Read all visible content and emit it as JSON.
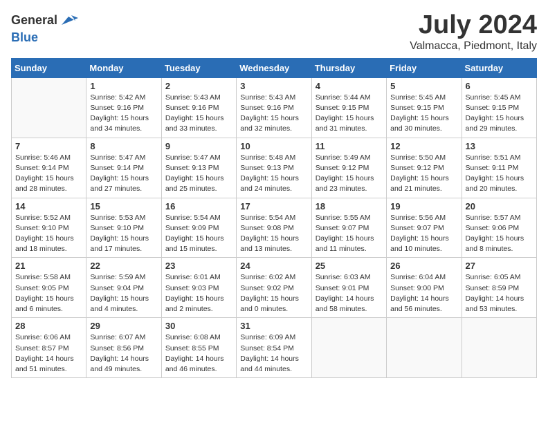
{
  "header": {
    "logo_line1": "General",
    "logo_line2": "Blue",
    "month_title": "July 2024",
    "location": "Valmacca, Piedmont, Italy"
  },
  "weekdays": [
    "Sunday",
    "Monday",
    "Tuesday",
    "Wednesday",
    "Thursday",
    "Friday",
    "Saturday"
  ],
  "weeks": [
    [
      {
        "day": "",
        "sunrise": "",
        "sunset": "",
        "daylight": ""
      },
      {
        "day": "1",
        "sunrise": "Sunrise: 5:42 AM",
        "sunset": "Sunset: 9:16 PM",
        "daylight": "Daylight: 15 hours and 34 minutes."
      },
      {
        "day": "2",
        "sunrise": "Sunrise: 5:43 AM",
        "sunset": "Sunset: 9:16 PM",
        "daylight": "Daylight: 15 hours and 33 minutes."
      },
      {
        "day": "3",
        "sunrise": "Sunrise: 5:43 AM",
        "sunset": "Sunset: 9:16 PM",
        "daylight": "Daylight: 15 hours and 32 minutes."
      },
      {
        "day": "4",
        "sunrise": "Sunrise: 5:44 AM",
        "sunset": "Sunset: 9:15 PM",
        "daylight": "Daylight: 15 hours and 31 minutes."
      },
      {
        "day": "5",
        "sunrise": "Sunrise: 5:45 AM",
        "sunset": "Sunset: 9:15 PM",
        "daylight": "Daylight: 15 hours and 30 minutes."
      },
      {
        "day": "6",
        "sunrise": "Sunrise: 5:45 AM",
        "sunset": "Sunset: 9:15 PM",
        "daylight": "Daylight: 15 hours and 29 minutes."
      }
    ],
    [
      {
        "day": "7",
        "sunrise": "Sunrise: 5:46 AM",
        "sunset": "Sunset: 9:14 PM",
        "daylight": "Daylight: 15 hours and 28 minutes."
      },
      {
        "day": "8",
        "sunrise": "Sunrise: 5:47 AM",
        "sunset": "Sunset: 9:14 PM",
        "daylight": "Daylight: 15 hours and 27 minutes."
      },
      {
        "day": "9",
        "sunrise": "Sunrise: 5:47 AM",
        "sunset": "Sunset: 9:13 PM",
        "daylight": "Daylight: 15 hours and 25 minutes."
      },
      {
        "day": "10",
        "sunrise": "Sunrise: 5:48 AM",
        "sunset": "Sunset: 9:13 PM",
        "daylight": "Daylight: 15 hours and 24 minutes."
      },
      {
        "day": "11",
        "sunrise": "Sunrise: 5:49 AM",
        "sunset": "Sunset: 9:12 PM",
        "daylight": "Daylight: 15 hours and 23 minutes."
      },
      {
        "day": "12",
        "sunrise": "Sunrise: 5:50 AM",
        "sunset": "Sunset: 9:12 PM",
        "daylight": "Daylight: 15 hours and 21 minutes."
      },
      {
        "day": "13",
        "sunrise": "Sunrise: 5:51 AM",
        "sunset": "Sunset: 9:11 PM",
        "daylight": "Daylight: 15 hours and 20 minutes."
      }
    ],
    [
      {
        "day": "14",
        "sunrise": "Sunrise: 5:52 AM",
        "sunset": "Sunset: 9:10 PM",
        "daylight": "Daylight: 15 hours and 18 minutes."
      },
      {
        "day": "15",
        "sunrise": "Sunrise: 5:53 AM",
        "sunset": "Sunset: 9:10 PM",
        "daylight": "Daylight: 15 hours and 17 minutes."
      },
      {
        "day": "16",
        "sunrise": "Sunrise: 5:54 AM",
        "sunset": "Sunset: 9:09 PM",
        "daylight": "Daylight: 15 hours and 15 minutes."
      },
      {
        "day": "17",
        "sunrise": "Sunrise: 5:54 AM",
        "sunset": "Sunset: 9:08 PM",
        "daylight": "Daylight: 15 hours and 13 minutes."
      },
      {
        "day": "18",
        "sunrise": "Sunrise: 5:55 AM",
        "sunset": "Sunset: 9:07 PM",
        "daylight": "Daylight: 15 hours and 11 minutes."
      },
      {
        "day": "19",
        "sunrise": "Sunrise: 5:56 AM",
        "sunset": "Sunset: 9:07 PM",
        "daylight": "Daylight: 15 hours and 10 minutes."
      },
      {
        "day": "20",
        "sunrise": "Sunrise: 5:57 AM",
        "sunset": "Sunset: 9:06 PM",
        "daylight": "Daylight: 15 hours and 8 minutes."
      }
    ],
    [
      {
        "day": "21",
        "sunrise": "Sunrise: 5:58 AM",
        "sunset": "Sunset: 9:05 PM",
        "daylight": "Daylight: 15 hours and 6 minutes."
      },
      {
        "day": "22",
        "sunrise": "Sunrise: 5:59 AM",
        "sunset": "Sunset: 9:04 PM",
        "daylight": "Daylight: 15 hours and 4 minutes."
      },
      {
        "day": "23",
        "sunrise": "Sunrise: 6:01 AM",
        "sunset": "Sunset: 9:03 PM",
        "daylight": "Daylight: 15 hours and 2 minutes."
      },
      {
        "day": "24",
        "sunrise": "Sunrise: 6:02 AM",
        "sunset": "Sunset: 9:02 PM",
        "daylight": "Daylight: 15 hours and 0 minutes."
      },
      {
        "day": "25",
        "sunrise": "Sunrise: 6:03 AM",
        "sunset": "Sunset: 9:01 PM",
        "daylight": "Daylight: 14 hours and 58 minutes."
      },
      {
        "day": "26",
        "sunrise": "Sunrise: 6:04 AM",
        "sunset": "Sunset: 9:00 PM",
        "daylight": "Daylight: 14 hours and 56 minutes."
      },
      {
        "day": "27",
        "sunrise": "Sunrise: 6:05 AM",
        "sunset": "Sunset: 8:59 PM",
        "daylight": "Daylight: 14 hours and 53 minutes."
      }
    ],
    [
      {
        "day": "28",
        "sunrise": "Sunrise: 6:06 AM",
        "sunset": "Sunset: 8:57 PM",
        "daylight": "Daylight: 14 hours and 51 minutes."
      },
      {
        "day": "29",
        "sunrise": "Sunrise: 6:07 AM",
        "sunset": "Sunset: 8:56 PM",
        "daylight": "Daylight: 14 hours and 49 minutes."
      },
      {
        "day": "30",
        "sunrise": "Sunrise: 6:08 AM",
        "sunset": "Sunset: 8:55 PM",
        "daylight": "Daylight: 14 hours and 46 minutes."
      },
      {
        "day": "31",
        "sunrise": "Sunrise: 6:09 AM",
        "sunset": "Sunset: 8:54 PM",
        "daylight": "Daylight: 14 hours and 44 minutes."
      },
      {
        "day": "",
        "sunrise": "",
        "sunset": "",
        "daylight": ""
      },
      {
        "day": "",
        "sunrise": "",
        "sunset": "",
        "daylight": ""
      },
      {
        "day": "",
        "sunrise": "",
        "sunset": "",
        "daylight": ""
      }
    ]
  ]
}
